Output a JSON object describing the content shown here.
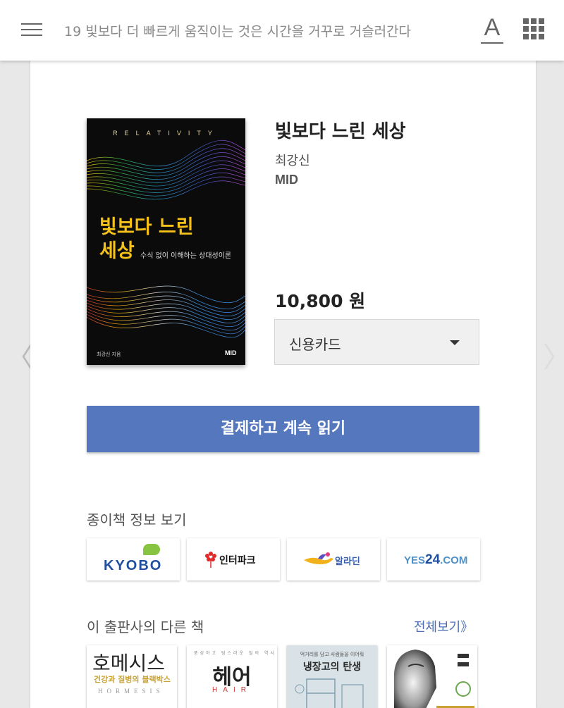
{
  "header": {
    "title": "19 빛보다 더 빠르게 움직이는 것은 시간을 거꾸로 거슬러간다",
    "font_icon_glyph": "A",
    "icons": [
      "menu-icon",
      "font-settings-icon",
      "apps-grid-icon"
    ]
  },
  "navigation": {
    "prev_glyph": "〈",
    "next_glyph": "〉"
  },
  "book": {
    "title": "빛보다 느린 세상",
    "author": "최강신",
    "publisher": "MID",
    "price": "10,800 원",
    "cover": {
      "series": "RELATIVITY",
      "title_line1": "빛보다 느린",
      "title_line2": "세상",
      "subtitle": "수식 없이 이해하는 상대성이론",
      "author_credit": "최강신 지음",
      "publisher_mark": "MID"
    }
  },
  "payment": {
    "selected_method": "신용카드",
    "button_label": "결제하고 계속 읽기"
  },
  "paper_book": {
    "label": "종이책 정보 보기",
    "stores": [
      "KYOBO",
      "인터파크",
      "알라딘",
      "YES24.COM"
    ]
  },
  "publisher_books": {
    "label": "이 출판사의 다른 책",
    "see_all": "전체보기》",
    "books": [
      {
        "title": "호메시스",
        "subtitle": "건강과 질병의 블랙박스",
        "latin": "HORMESIS"
      },
      {
        "title": "헤어",
        "latin": "HAIR",
        "top_text": "풍성하고 탐스러운 털의 역사"
      },
      {
        "title": "냉장고의 탄생",
        "top_text": "먹거리를 담고 사람들을 이어줘"
      },
      {
        "title": "",
        "note": ""
      }
    ]
  },
  "colors": {
    "accent": "#5577bd",
    "cover_title": "#f6c21a",
    "link": "#4d6fb8"
  }
}
